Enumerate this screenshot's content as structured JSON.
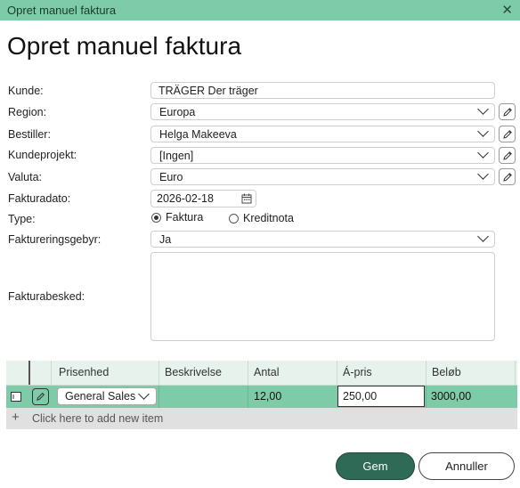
{
  "window": {
    "title": "Opret manuel faktura"
  },
  "heading": "Opret manuel faktura",
  "form": {
    "kunde": {
      "label": "Kunde:",
      "value": "TRÄGER Der träger"
    },
    "region": {
      "label": "Region:",
      "value": "Europa"
    },
    "bestiller": {
      "label": "Bestiller:",
      "value": "Helga Makeeva"
    },
    "kundeprojekt": {
      "label": "Kundeprojekt:",
      "value": "[Ingen]"
    },
    "valuta": {
      "label": "Valuta:",
      "value": "Euro"
    },
    "fakturadato": {
      "label": "Fakturadato:",
      "value": "2026-02-18"
    },
    "type": {
      "label": "Type:",
      "options": [
        "Faktura",
        "Kreditnota"
      ],
      "selected": "Faktura"
    },
    "fakturagebyr": {
      "label": "Faktureringsgebyr:",
      "value": "Ja"
    },
    "besked": {
      "label": "Fakturabesked:",
      "value": ""
    }
  },
  "grid": {
    "headers": [
      "Prisenhed",
      "Beskrivelse",
      "Antal",
      "Á-pris",
      "Beløb"
    ],
    "rows": [
      {
        "prisenhed": "General Sales",
        "beskrivelse": "",
        "antal": "12,00",
        "apris": "250,00",
        "belob": "3000,00"
      }
    ],
    "add_label": "Click here to add new item"
  },
  "buttons": {
    "save": "Gem",
    "cancel": "Annuller"
  },
  "colors": {
    "accent": "#7ecba9",
    "primary_button": "#2e6a56"
  }
}
